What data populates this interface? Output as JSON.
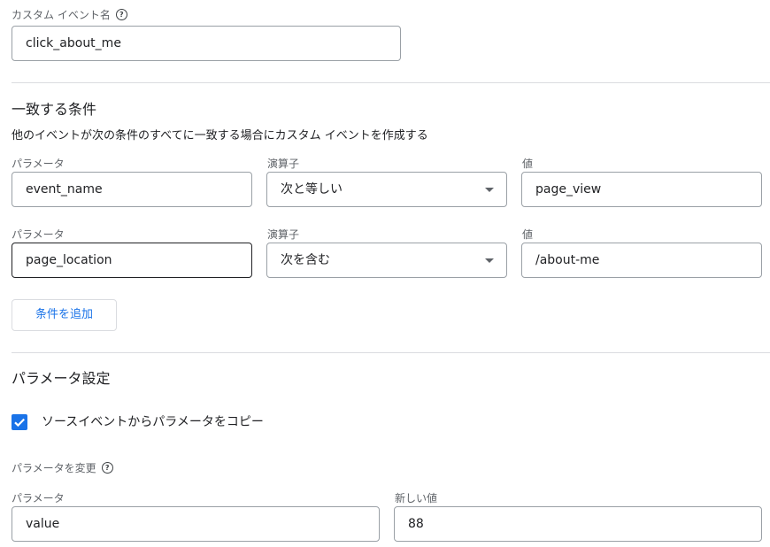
{
  "custom_event": {
    "label": "カスタム イベント名",
    "help_icon": "help-icon",
    "value": "click_about_me"
  },
  "conditions": {
    "title": "一致する条件",
    "description": "他のイベントが次の条件のすべてに一致する場合にカスタム イベントを作成する",
    "rows": [
      {
        "parameter_label": "パラメータ",
        "parameter_value": "event_name",
        "operator_label": "演算子",
        "operator_value": "次と等しい",
        "value_label": "値",
        "value": "page_view"
      },
      {
        "parameter_label": "パラメータ",
        "parameter_value": "page_location",
        "operator_label": "演算子",
        "operator_value": "次を含む",
        "value_label": "値",
        "value": "/about-me"
      }
    ],
    "add_button": "条件を追加"
  },
  "parameter_settings": {
    "title": "パラメータ設定",
    "copy_checkbox": {
      "label": "ソースイベントからパラメータをコピー",
      "checked": true
    },
    "modify_label": "パラメータを変更",
    "modify_help_icon": "help-icon",
    "modify_row": {
      "parameter_label": "パラメータ",
      "parameter_value": "value",
      "new_value_label": "新しい値",
      "new_value": "88"
    }
  },
  "colors": {
    "accent": "#1a73e8",
    "border": "#9aa0a6",
    "divider": "#dadce0",
    "text": "#202124",
    "muted": "#5f6368"
  }
}
